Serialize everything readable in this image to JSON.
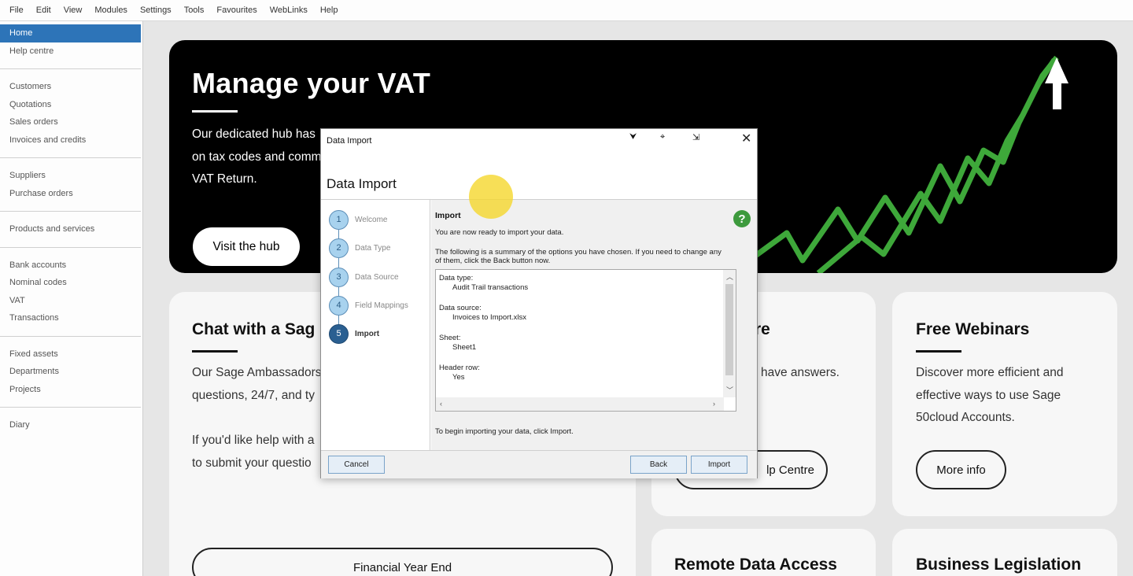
{
  "menu": [
    "File",
    "Edit",
    "View",
    "Modules",
    "Settings",
    "Tools",
    "Favourites",
    "WebLinks",
    "Help"
  ],
  "sidebar": {
    "groups": [
      [
        "Home",
        "Help centre"
      ],
      [
        "Customers",
        "Quotations",
        "Sales orders",
        "Invoices and credits"
      ],
      [
        "Suppliers",
        "Purchase orders"
      ],
      [
        "Products and services"
      ],
      [
        "Bank accounts",
        "Nominal codes",
        "VAT",
        "Transactions"
      ],
      [
        "Fixed assets",
        "Departments",
        "Projects"
      ],
      [
        "Diary"
      ]
    ],
    "active": "Home"
  },
  "hero": {
    "title": "Manage your VAT",
    "line1": "Our dedicated hub has",
    "line2": "on tax codes and comm",
    "line3": "VAT Return.",
    "button": "Visit the hub"
  },
  "cards": {
    "chat": {
      "title": "Chat with a Sag",
      "line1": "Our Sage Ambassadors",
      "line2": "questions, 24/7, and ty",
      "line3": "If you'd like help with a",
      "line4": "to submit your questio",
      "button": "Financial Year End"
    },
    "help": {
      "title": "re",
      "line1": "have answers.",
      "button": "lp Centre"
    },
    "webinars": {
      "title": "Free Webinars",
      "line1": "Discover more efficient and",
      "line2": "effective ways to use Sage",
      "line3": "50cloud Accounts.",
      "button": "More info"
    },
    "remote": {
      "title": "Remote Data Access"
    },
    "legislation": {
      "title": "Business Legislation"
    }
  },
  "dialog": {
    "window_title": "Data Import",
    "heading": "Data Import",
    "steps": [
      {
        "num": "1",
        "label": "Welcome"
      },
      {
        "num": "2",
        "label": "Data Type"
      },
      {
        "num": "3",
        "label": "Data Source"
      },
      {
        "num": "4",
        "label": "Field Mappings"
      },
      {
        "num": "5",
        "label": "Import"
      }
    ],
    "active_step": "5",
    "pane_title": "Import",
    "ready_text": "You are now ready to import your data.",
    "summary_line1": "The following is a summary of the options you have chosen. If you need to change any",
    "summary_line2": "of them, click the Back button now.",
    "summary": {
      "data_type_label": "Data type:",
      "data_type_value": "Audit Trail transactions",
      "data_source_label": "Data source:",
      "data_source_value": "Invoices to Import.xlsx",
      "sheet_label": "Sheet:",
      "sheet_value": "Sheet1",
      "header_label": "Header row:",
      "header_value": "Yes"
    },
    "footer_text": "To begin importing your data, click Import.",
    "buttons": {
      "cancel": "Cancel",
      "back": "Back",
      "import": "Import"
    }
  },
  "colors": {
    "active_sidebar": "#2d74b8",
    "step_active": "#2a5f91",
    "help_icon": "#3d9a3d",
    "hero_trend": "#3ea83a"
  },
  "icons": {
    "help": "?",
    "close": "✕",
    "ctrl1": "⮟",
    "ctrl2": "⌖",
    "ctrl3": "⇲"
  }
}
